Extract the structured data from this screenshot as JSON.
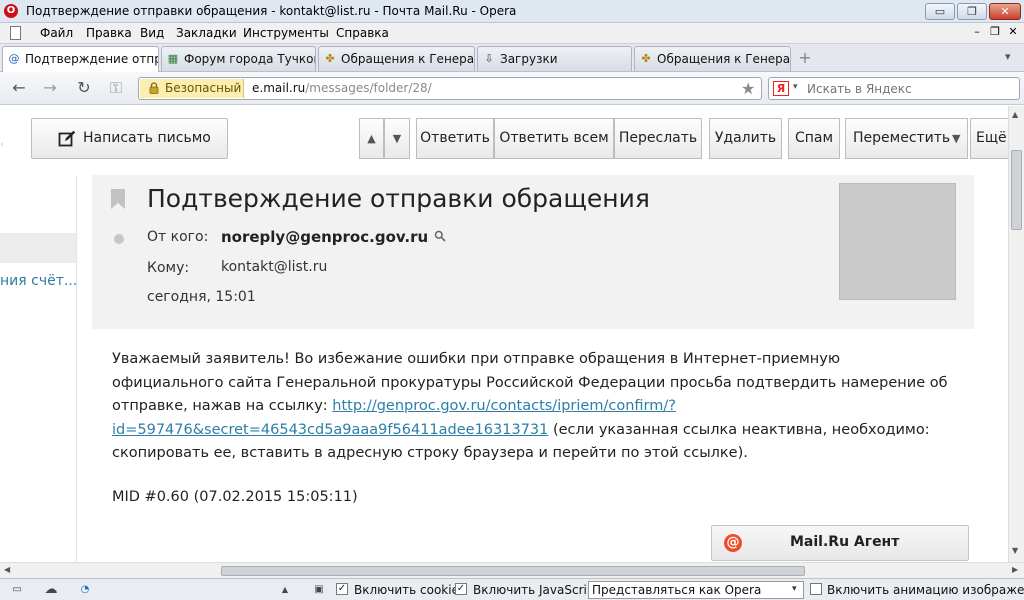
{
  "window": {
    "title": "Подтверждение отправки обращения - kontakt@list.ru - Почта Mail.Ru - Opera",
    "logo_letter": "O",
    "controls": {
      "minimize": "▭",
      "maximize": "❐",
      "close": "✕"
    }
  },
  "menu": {
    "items": [
      "Файл",
      "Правка",
      "Вид",
      "Закладки",
      "Инструменты",
      "Справка"
    ],
    "mdi": {
      "minimize": "–",
      "restore": "❐",
      "close": "✕"
    }
  },
  "tabs": [
    {
      "label": "Подтверждение отпра...",
      "icon": "@",
      "active": true
    },
    {
      "label": "Форум города Тучков...",
      "icon": "▦",
      "active": false
    },
    {
      "label": "Обращения к Генерал...",
      "icon": "✤",
      "active": false
    },
    {
      "label": "Загрузки",
      "icon": "⇩",
      "active": false
    },
    {
      "label": "Обращения к Генерал...",
      "icon": "✤",
      "active": false
    }
  ],
  "tab_controls": {
    "new_tab": "+",
    "list": "▾"
  },
  "nav": {
    "back": "←",
    "forward": "→",
    "reload": "↻",
    "key": "⚿",
    "secure_label": "Безопасный",
    "url_host": "e.mail.ru",
    "url_path": "/messages/folder/28/",
    "star": "★",
    "search_engine_letter": "Я",
    "search_arrow": "▾",
    "search_placeholder": "Искать в Яндекс"
  },
  "toolbar": {
    "compose_label": "Написать письмо",
    "up_arrow": "▲",
    "down_arrow": "▼",
    "reply": "Ответить",
    "reply_all": "Ответить всем",
    "forward": "Переслать",
    "delete": "Удалить",
    "spam": "Спам",
    "move": "Переместить",
    "move_arrow": "▼",
    "more": "Ещё"
  },
  "sidebar": {
    "mark": "‹",
    "item_text": "ния счёт..."
  },
  "message": {
    "subject": "Подтверждение отправки обращения",
    "from_label": "От кого:",
    "from_value": "noreply@genproc.gov.ru",
    "to_label": "Кому:",
    "to_value": "kontakt@list.ru",
    "date": "сегодня, 15:01",
    "body_part1": "Уважаемый заявитель! Во избежание ошибки при отправке обращения в Интернет-приемную официального сайта Генеральной прокуратуры Российской Федерации просьба подтвердить намерение об отправке, нажав на ссылку: ",
    "link": "http://genproc.gov.ru/contacts/ipriem/confirm/?id=597476&secret=46543cd5a9aaa9f56411adee16313731",
    "body_part2": " (если указанная ссылка неактивна, необходимо: скопировать ее, вставить в адресную строку браузера и перейти по этой ссылке).",
    "mid": "MID #0.60 (07.02.2015 15:05:11)"
  },
  "agent": {
    "icon_letter": "@",
    "label": "Mail.Ru Агент"
  },
  "scroll": {
    "up": "▲",
    "down": "▼",
    "left": "◀",
    "right": "▶"
  },
  "statusbar": {
    "icons": {
      "panel": "▭",
      "cloud": "☁",
      "speed": "◔",
      "up": "▲",
      "image": "▣"
    },
    "check_mark": "✓",
    "cookies_label": "Включить cookies",
    "cookies_checked": true,
    "javascript_label": "Включить JavaScript",
    "javascript_checked": true,
    "identify_value": "Представляться как Opera",
    "identify_arrow": "▾",
    "animation_label": "Включить анимацию изображений",
    "animation_checked": false
  }
}
